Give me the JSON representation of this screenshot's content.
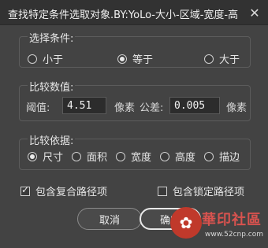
{
  "window": {
    "title": "查找特定条件选取对象.BY:YoLo-大小-区域-宽度-高...",
    "close_glyph": "✕"
  },
  "selection": {
    "legend": "选择条件:",
    "options": [
      {
        "label": "小于",
        "checked": false
      },
      {
        "label": "等于",
        "checked": true
      },
      {
        "label": "大于",
        "checked": false
      }
    ]
  },
  "values": {
    "legend": "比较数值:",
    "threshold_label": "阈值:",
    "threshold_value": "4.51",
    "threshold_unit": "像素",
    "tolerance_label": "公差:",
    "tolerance_value": "0.005",
    "tolerance_unit": "像素"
  },
  "basis": {
    "legend": "比较依据:",
    "options": [
      {
        "label": "尺寸",
        "checked": true
      },
      {
        "label": "面积",
        "checked": false
      },
      {
        "label": "宽度",
        "checked": false
      },
      {
        "label": "高度",
        "checked": false
      },
      {
        "label": "描边",
        "checked": false
      }
    ]
  },
  "checks": {
    "compound": {
      "label": "包含复合路径项",
      "checked": true
    },
    "locked": {
      "label": "包含锁定路径项",
      "checked": false
    }
  },
  "buttons": {
    "cancel": "取消",
    "ok": "确定"
  },
  "watermark": {
    "seal_glyph": "✿",
    "site_name": "華印社區",
    "url": "www.52cnp.com"
  },
  "colors": {
    "background": "#434343",
    "titlebar": "#323232",
    "field_bg": "#2c2c2c",
    "watermark_red": "#d9534f"
  }
}
